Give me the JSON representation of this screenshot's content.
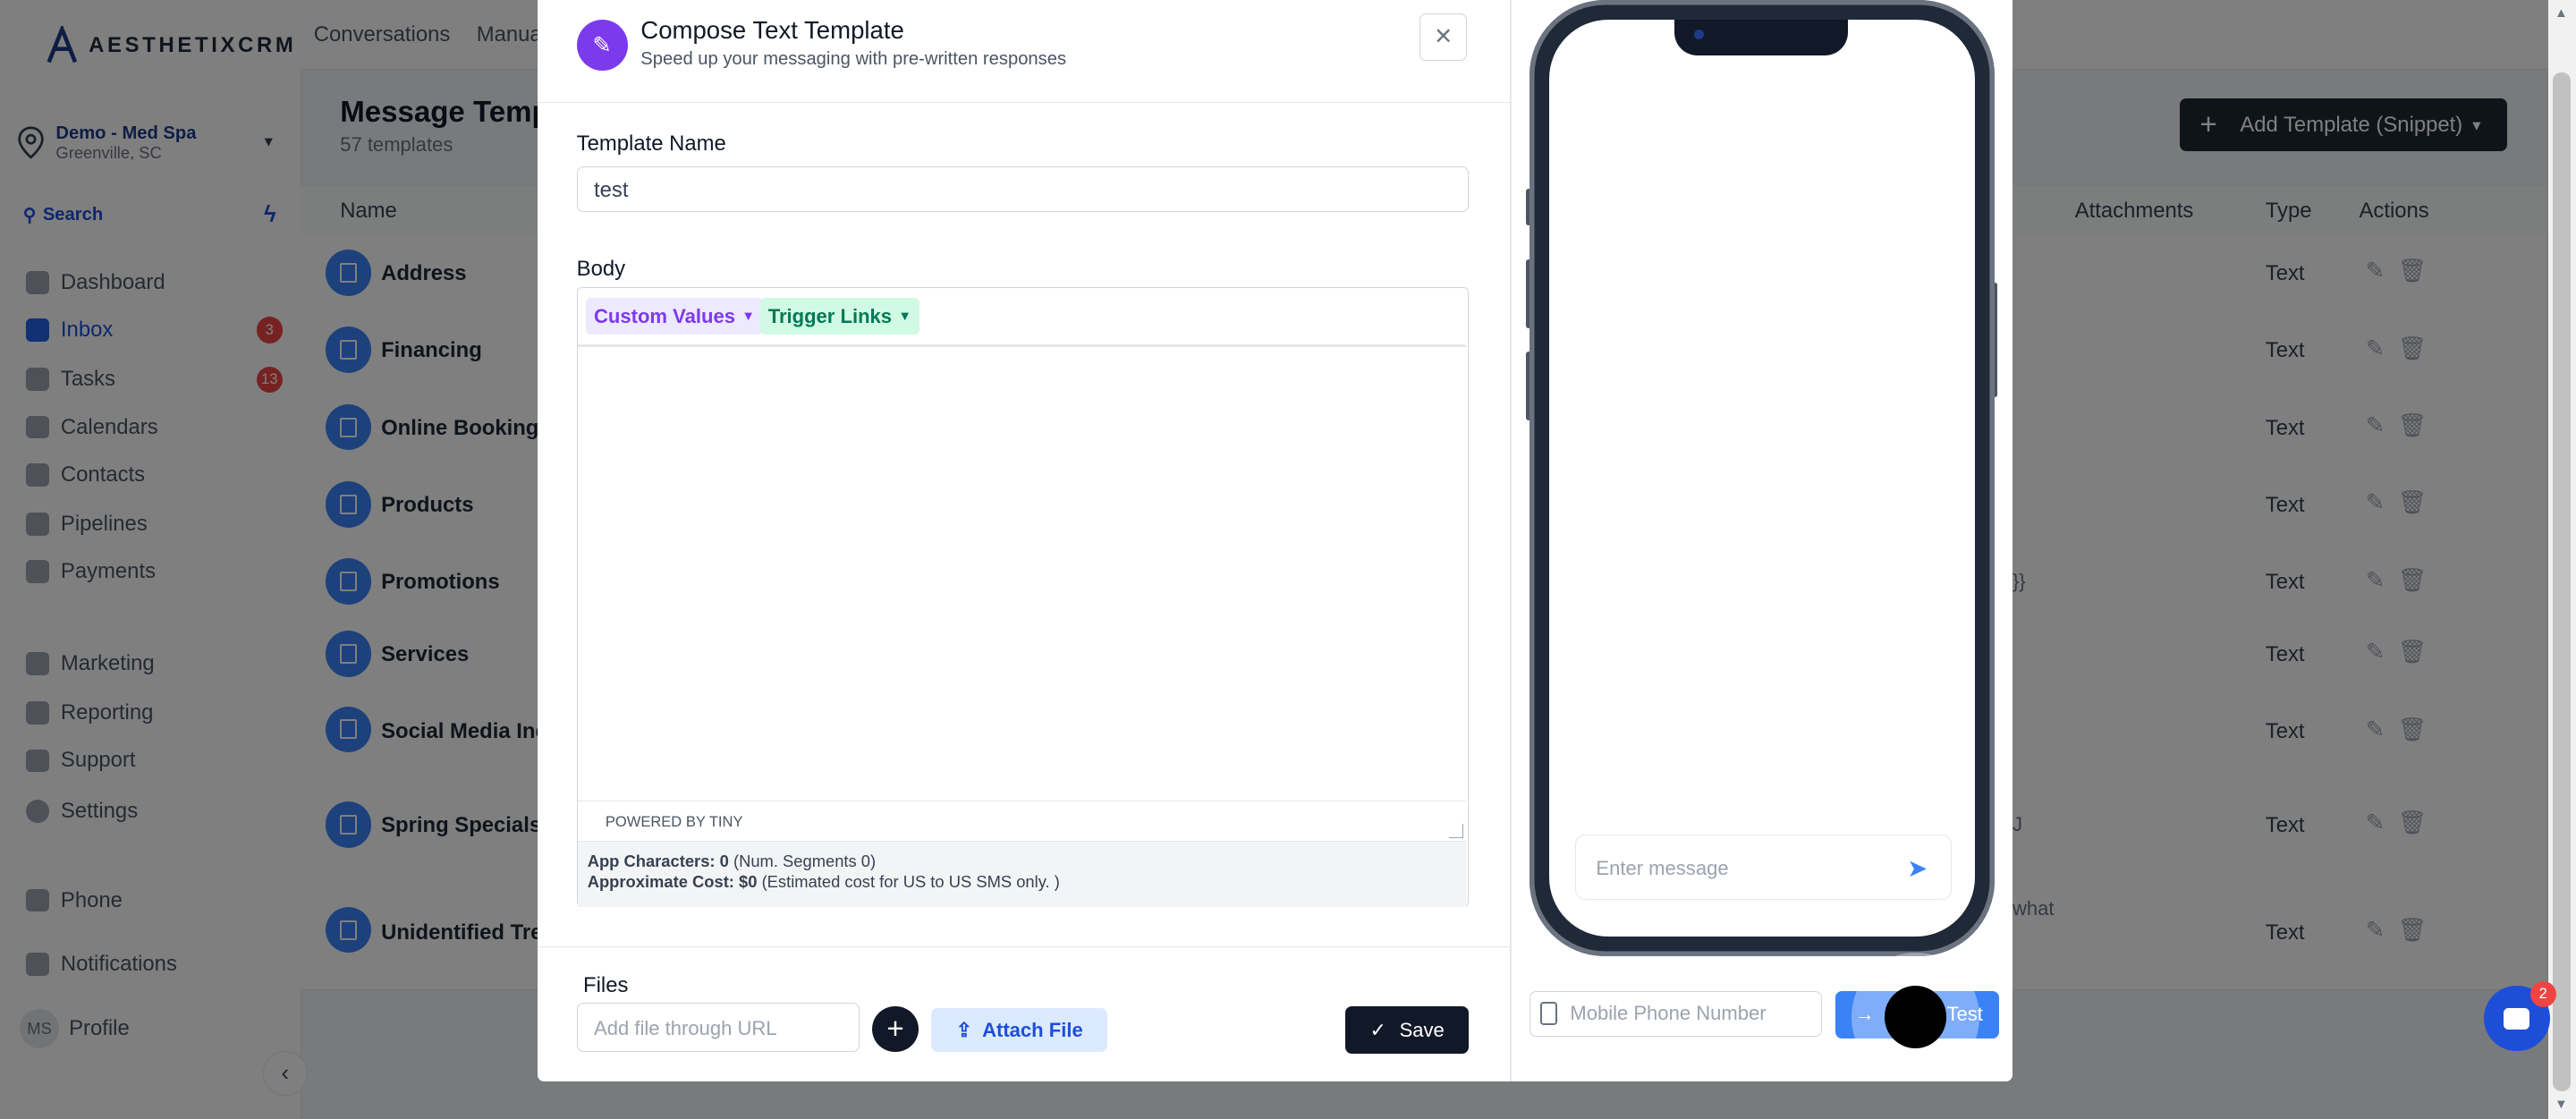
{
  "app": {
    "logo_text": "AESTHETIXCRM"
  },
  "location": {
    "name": "Demo - Med Spa",
    "city": "Greenville, SC"
  },
  "sidebar": {
    "search_label": "Search",
    "items": [
      {
        "label": "Dashboard",
        "icon": "dashboard-icon"
      },
      {
        "label": "Inbox",
        "icon": "inbox-icon",
        "badge": "3"
      },
      {
        "label": "Tasks",
        "icon": "tasks-icon",
        "badge": "13"
      },
      {
        "label": "Calendars",
        "icon": "calendar-icon"
      },
      {
        "label": "Contacts",
        "icon": "contacts-icon"
      },
      {
        "label": "Pipelines",
        "icon": "pipelines-icon"
      },
      {
        "label": "Payments",
        "icon": "payments-icon"
      },
      {
        "label": "Marketing",
        "icon": "marketing-icon"
      },
      {
        "label": "Reporting",
        "icon": "reporting-icon"
      },
      {
        "label": "Support",
        "icon": "support-icon"
      },
      {
        "label": "Settings",
        "icon": "settings-icon"
      },
      {
        "label": "Phone",
        "icon": "phone-icon"
      },
      {
        "label": "Notifications",
        "icon": "bell-icon"
      },
      {
        "label": "Profile",
        "icon": "avatar",
        "initials": "MS"
      }
    ]
  },
  "topnav": {
    "tabs": [
      "Conversations",
      "Manual"
    ]
  },
  "page": {
    "title": "Message Temp",
    "subtitle": "57 templates",
    "add_button": "Add Template (Snippet)"
  },
  "table": {
    "headers": {
      "name": "Name",
      "attachments": "Attachments",
      "type": "Type",
      "actions": "Actions"
    },
    "rows": [
      {
        "name": "Address",
        "type": "Text"
      },
      {
        "name": "Financing",
        "type": "Text"
      },
      {
        "name": "Online Booking",
        "type": "Text"
      },
      {
        "name": "Products",
        "type": "Text"
      },
      {
        "name": "Promotions",
        "type": "Text",
        "extra": "}}"
      },
      {
        "name": "Services",
        "type": "Text"
      },
      {
        "name": "Social Media Inqu",
        "type": "Text"
      },
      {
        "name": "Spring Specials",
        "type": "Text",
        "extra": "J"
      },
      {
        "name": "Unidentified Trea",
        "type": "Text",
        "extra": "what"
      }
    ]
  },
  "modal": {
    "title": "Compose Text Template",
    "subtitle": "Speed up your messaging with pre-written responses",
    "template_name_label": "Template Name",
    "template_name_value": "test",
    "body_label": "Body",
    "custom_values": "Custom Values",
    "trigger_links": "Trigger Links",
    "powered_by": "POWERED BY TINY",
    "app_characters_label": "App Characters: 0",
    "app_characters_note": "(Num. Segments 0)",
    "approx_cost_label": "Approximate Cost: $0",
    "approx_cost_note": "(Estimated cost for US to US SMS only. )",
    "files_label": "Files",
    "url_placeholder": "Add file through URL",
    "attach_file": "Attach File",
    "save": "Save"
  },
  "preview": {
    "message_placeholder": "Enter message",
    "mobile_placeholder": "Mobile Phone Number",
    "test_button": "Test"
  },
  "chat_widget": {
    "badge": "2"
  }
}
